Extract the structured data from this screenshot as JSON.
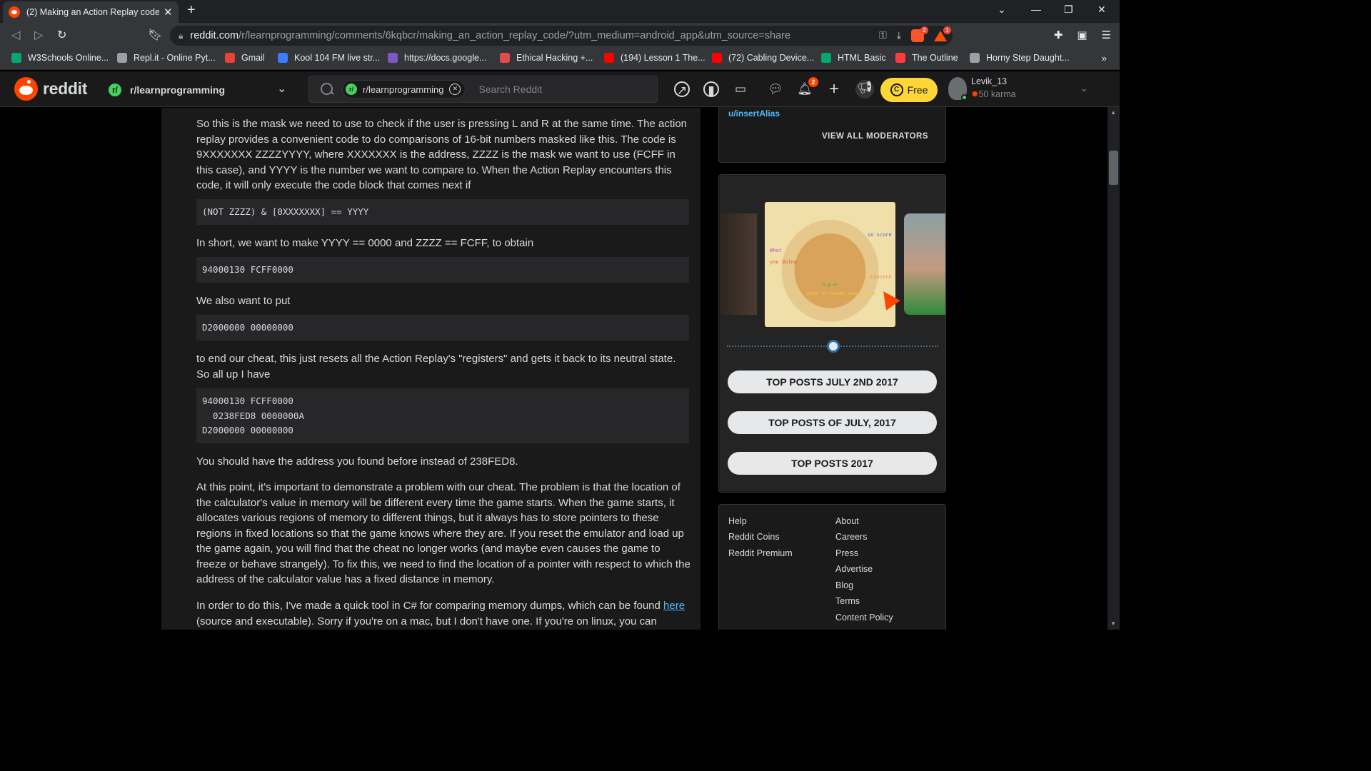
{
  "browser": {
    "tab_title": "(2) Making an Action Replay code",
    "new_tab": "+",
    "url_host": "reddit.com",
    "url_path": "/r/learnprogramming/comments/6kqbcr/making_an_action_replay_code/?utm_medium=android_app&utm_source=share",
    "brave_shield_count": "2",
    "rewards_count": "1",
    "bookmarks": [
      {
        "label": "W3Schools Online...",
        "icon": "w3schools-icon",
        "color": "#04aa6d"
      },
      {
        "label": "Repl.it - Online Pyt...",
        "icon": "replit-icon",
        "color": "#9aa0a6"
      },
      {
        "label": "Gmail",
        "icon": "gmail-icon",
        "color": "#ea4335"
      },
      {
        "label": "Kool 104 FM live str...",
        "icon": "play-icon",
        "color": "#3d7bfd"
      },
      {
        "label": "https://docs.google...",
        "icon": "docs-icon",
        "color": "#7e57c2"
      },
      {
        "label": "Ethical Hacking +...",
        "icon": "udemy-icon",
        "color": "#e04b4b"
      },
      {
        "label": "(194) Lesson 1 The...",
        "icon": "youtube-icon",
        "color": "#ff0000"
      },
      {
        "label": "(72) Cabling Device...",
        "icon": "youtube-icon",
        "color": "#ff0000"
      },
      {
        "label": "HTML Basic",
        "icon": "w3schools-icon",
        "color": "#04aa6d"
      },
      {
        "label": "The Outline",
        "icon": "outline-icon",
        "color": "#ff3b3b"
      },
      {
        "label": "Horny Step Daught...",
        "icon": "globe-icon",
        "color": "#9aa0a6"
      }
    ],
    "bookmarks_more": "»"
  },
  "reddit": {
    "wordmark": "reddit",
    "subreddit": "r/learnprogramming",
    "search_chip": "r/learnprogramming",
    "search_placeholder": "Search Reddit",
    "notifications_count": "2",
    "free_label": "Free",
    "username": "Levik_13",
    "karma": "50 karma"
  },
  "post": {
    "p1": "So this is the mask we need to use to check if the user is pressing L and R at the same time. The action replay provides a convenient code to do comparisons of 16-bit numbers masked like this. The code is 9XXXXXXX ZZZZYYYY, where XXXXXXX is the address, ZZZZ is the mask we want to use (FCFF in this case), and YYYY is the number we want to compare to. When the Action Replay encounters this code, it will only execute the code block that comes next if",
    "code1": "(NOT ZZZZ) & [0XXXXXXX] == YYYY",
    "p2": "In short, we want to make YYYY == 0000 and ZZZZ == FCFF, to obtain",
    "code2": "94000130 FCFF0000",
    "p3": "We also want to put",
    "code3": "D2000000 00000000",
    "p4": "to end our cheat, this just resets all the Action Replay's \"registers\" and gets it back to its neutral state. So all up I have",
    "code4": "94000130 FCFF0000\n  0238FED8 0000000A\nD2000000 00000000",
    "p5": "You should have the address you found before instead of 238FED8.",
    "p6": "At this point, it's important to demonstrate a problem with our cheat. The problem is that the location of the calculator's value in memory will be different every time the game starts. When the game starts, it allocates various regions of memory to different things, but it always has to store pointers to these regions in fixed locations so that the game knows where they are. If you reset the emulator and load up the game again, you will find that the cheat no longer works (and maybe even causes the game to freeze or behave strangely). To fix this, we need to find the location of a pointer with respect to which the address of the calculator value has a fixed distance in memory.",
    "p7_before": "In order to do this, I've made a quick tool in C# for comparing memory dumps, which can be found ",
    "p7_link": "here",
    "p7_after": " (source and executable). Sorry if you're on a mac, but I don't have one. If you're on linux, you can"
  },
  "sidebar": {
    "moderator": "u/insertAlias",
    "view_all": "VIEW ALL MODERATORS",
    "banner_texts": [
      "What",
      "you doing",
      "so score",
      "Concern",
      "n-p-e",
      "keep ur hands away from"
    ],
    "top_buttons": [
      "TOP POSTS JULY 2ND 2017",
      "TOP POSTS OF JULY, 2017",
      "TOP POSTS 2017"
    ],
    "footer_left": [
      "Help",
      "Reddit Coins",
      "Reddit Premium"
    ],
    "footer_right": [
      "About",
      "Careers",
      "Press",
      "Advertise",
      "Blog",
      "Terms",
      "Content Policy"
    ]
  }
}
